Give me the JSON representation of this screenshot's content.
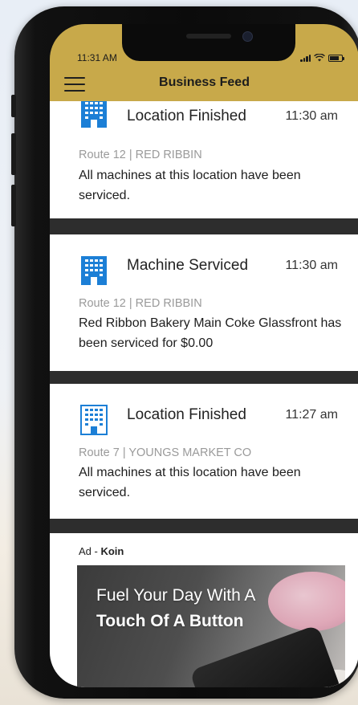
{
  "status_bar": {
    "time": "11:31 AM"
  },
  "header": {
    "title": "Business Feed",
    "menu_icon": "hamburger-menu-icon"
  },
  "colors": {
    "header_bg": "#c8a94a",
    "icon_blue": "#1c7fd6",
    "divider": "#2d2d2d"
  },
  "feed": {
    "items": [
      {
        "icon": "building-icon",
        "title": "Location Finished",
        "time": "11:30 am",
        "route": "Route 12 | RED RIBBIN",
        "description": "All machines at this location have been serviced."
      },
      {
        "icon": "building-icon",
        "title": "Machine Serviced",
        "time": "11:30 am",
        "route": "Route 12 | RED RIBBIN",
        "description": "Red Ribbon Bakery Main Coke Glassfront has been serviced for $0.00"
      },
      {
        "icon": "building-icon",
        "title": "Location Finished",
        "time": "11:27 am",
        "route": "Route 7 | YOUNGS MARKET CO",
        "description": "All machines at this location have been serviced."
      }
    ],
    "ad": {
      "prefix": "Ad - ",
      "sponsor": "Koin",
      "headline_line1": "Fuel Your Day With A",
      "headline_line2": "Touch Of A Button"
    }
  }
}
